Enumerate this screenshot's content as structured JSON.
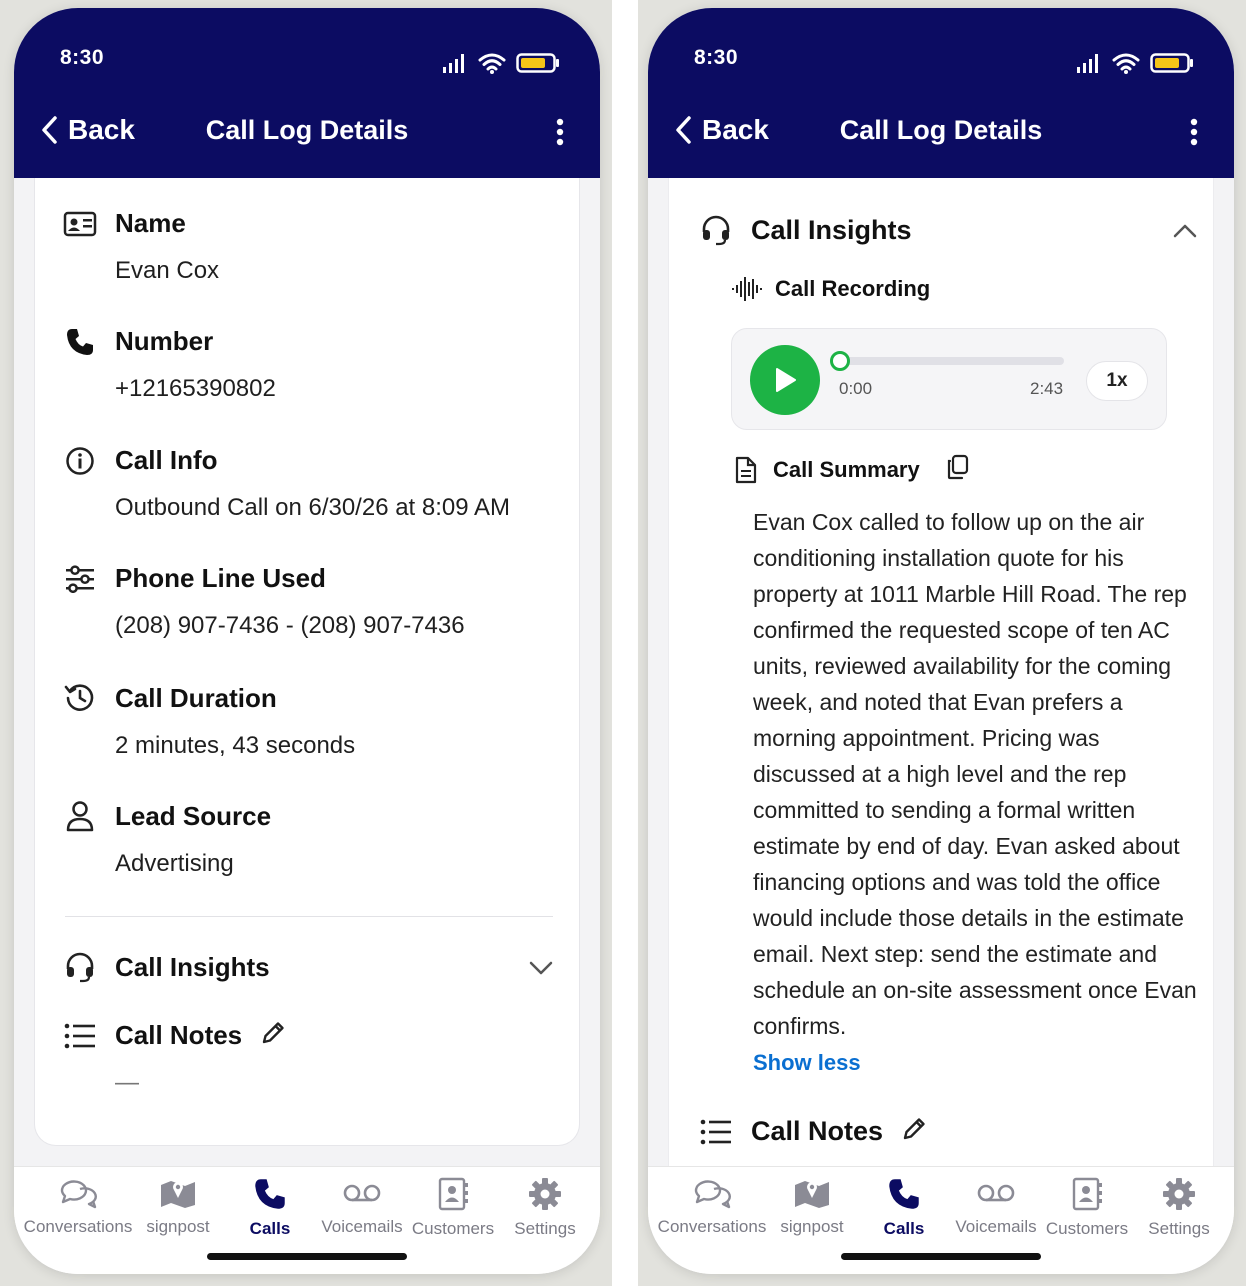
{
  "status_bar": {
    "time": "8:30"
  },
  "nav": {
    "back_label": "Back",
    "title": "Call Log Details"
  },
  "details": {
    "name": {
      "label": "Name",
      "value": "Evan Cox"
    },
    "number": {
      "label": "Number",
      "value": "+12165390802"
    },
    "call_info": {
      "label": "Call Info",
      "value": "Outbound Call on 6/30/26 at 8:09 AM"
    },
    "phone_line": {
      "label": "Phone Line Used",
      "value": "(208) 907-7436 - (208) 907-7436"
    },
    "duration": {
      "label": "Call Duration",
      "value": "2 minutes, 43 seconds"
    },
    "lead_source": {
      "label": "Lead Source",
      "value": "Advertising"
    }
  },
  "call_insights": {
    "label": "Call Insights"
  },
  "call_notes": {
    "label": "Call Notes",
    "value": "—"
  },
  "recording": {
    "label": "Call Recording",
    "current_time": "0:00",
    "total_time": "2:43",
    "speed": "1x",
    "progress": 0
  },
  "summary": {
    "label": "Call Summary",
    "lines": [
      "Evan Cox called to follow up on the air",
      "conditioning installation quote for his",
      "property at 1011 Marble Hill Road. The rep",
      "confirmed the requested scope of ten AC",
      "units, reviewed availability for the coming",
      "week, and noted that Evan prefers a",
      "morning appointment. Pricing was",
      "discussed at a high level and the rep",
      "committed to sending a formal written",
      "estimate by end of day. Evan asked about",
      "financing options and was told the office",
      "would include those details in the estimate",
      "email. Next step: send the estimate and",
      "schedule an on-site assessment once Evan",
      "confirms."
    ],
    "show_less": "Show less"
  },
  "tabs": [
    "Conversations",
    "signpost",
    "Calls",
    "Voicemails",
    "Customers",
    "Settings"
  ],
  "colors": {
    "header": "#0c0c62",
    "accent_green": "#1db345",
    "link_blue": "#0a6fd1"
  }
}
